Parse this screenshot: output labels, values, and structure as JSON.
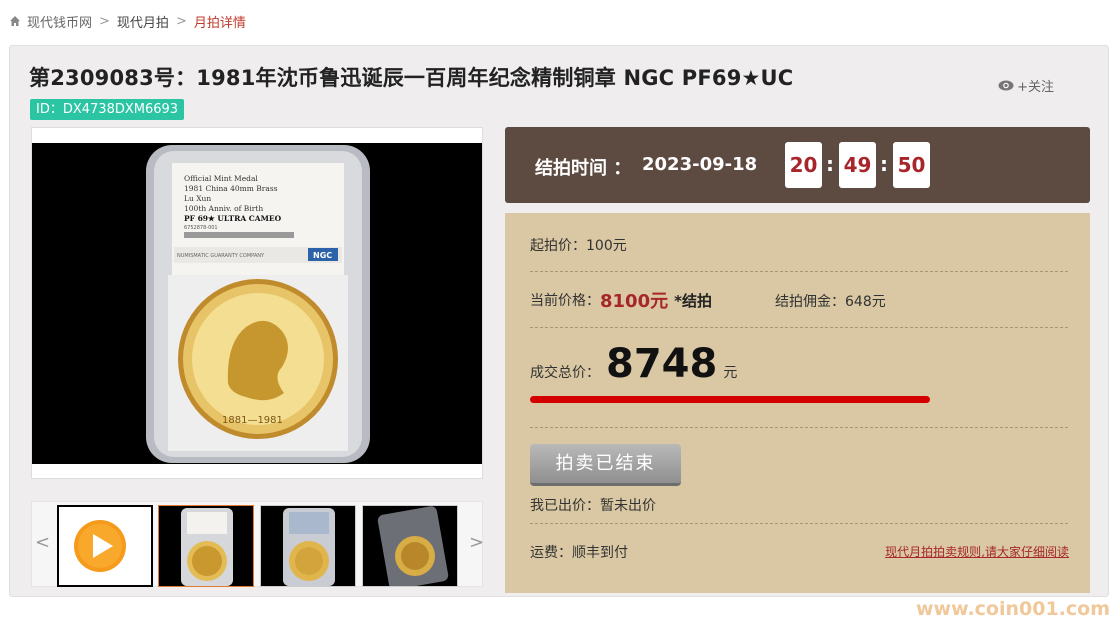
{
  "breadcrumb": {
    "home": "现代钱币网",
    "section": "现代月拍",
    "current": "月拍详情"
  },
  "lot": {
    "title": "第2309083号：1981年沈币鲁迅诞辰一百周年纪念精制铜章 NGC PF69★UC",
    "id_label": "ID：DX4738DXM6693",
    "follow": "+关注"
  },
  "slab": {
    "line1": "Official Mint Medal",
    "line2": "1981 China 40mm Brass",
    "line3": "Lu Xun",
    "line4": "100th Anniv. of Birth",
    "grade": "PF 69★ ULTRA CAMEO",
    "cert": "6752878-001",
    "footer": "NUMISMATIC GUARANTY COMPANY",
    "logo": "NGC",
    "coin_legend": "鲁迅诞辰一百周年纪念",
    "coin_years": "1881—1981"
  },
  "timer": {
    "label": "结拍时间 ：",
    "date": "2023-09-18",
    "hour": "20",
    "minute": "49",
    "second": "50",
    "sep": ":"
  },
  "info": {
    "start_price": "起拍价：100元",
    "current_label": "当前价格：",
    "current_value": "8100元",
    "current_note": "*结拍",
    "commission": "结拍佣金：648元",
    "total_label": "成交总价：",
    "total_value": "8748",
    "total_unit": "元",
    "end_button": "拍卖已结束",
    "my_bid": "我已出价：暂未出价",
    "shipping": "运费：顺丰到付",
    "rules_link": "现代月拍拍卖规则,请大家仔细阅读"
  },
  "gallery": {
    "prev": "<",
    "next": ">"
  },
  "colors": {
    "accent_red": "#a7262b",
    "id_green": "#2bc5a4",
    "timer_bg": "#5d4a40",
    "info_bg": "#d9c8a3",
    "play_orange": "#f59a1b"
  },
  "watermark": "www.coin001.com"
}
